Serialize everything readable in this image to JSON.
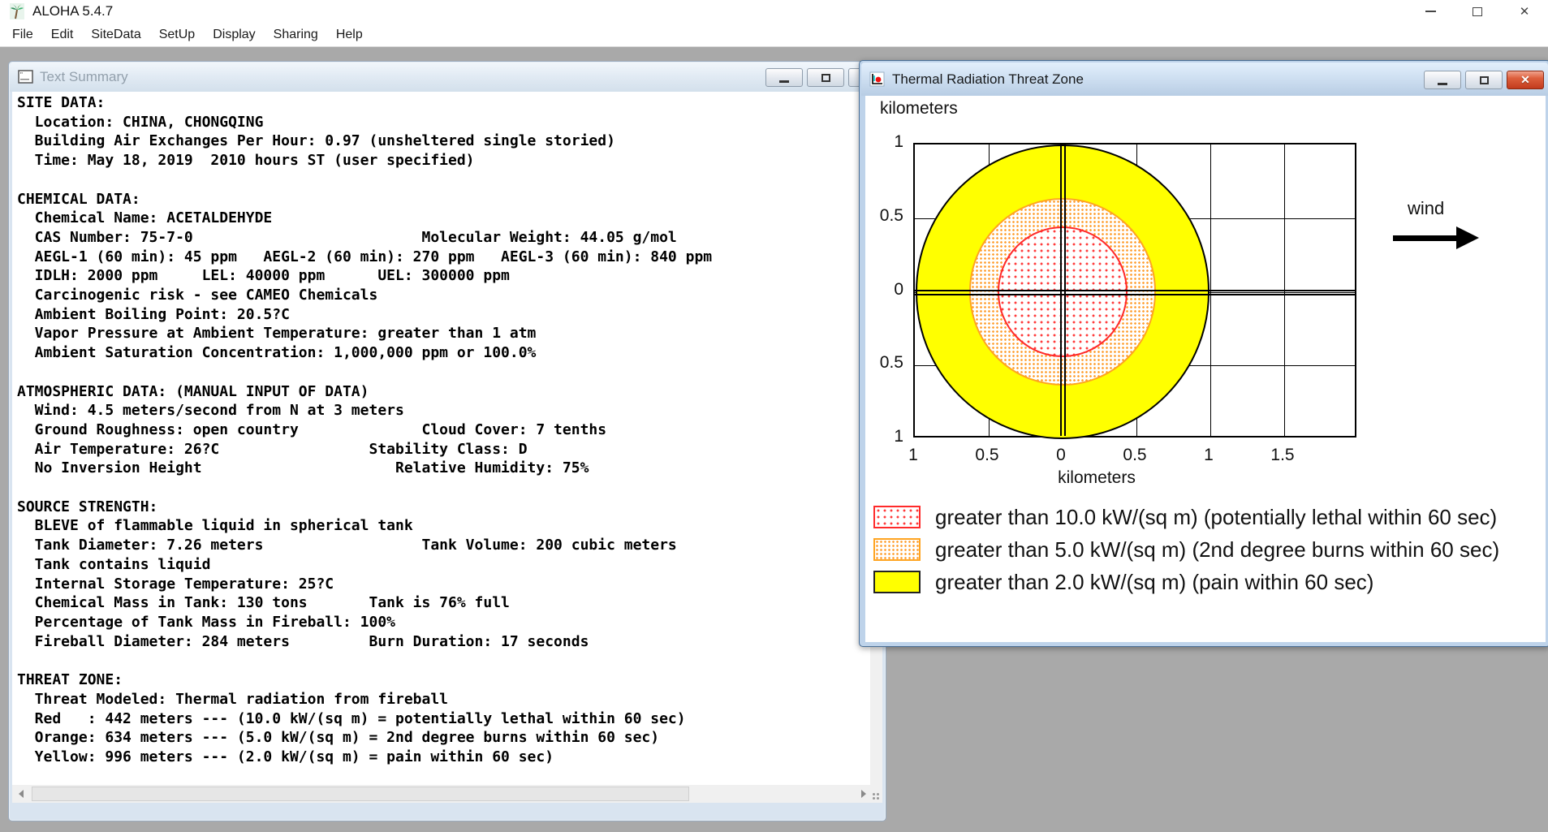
{
  "app": {
    "title": "ALOHA 5.4.7",
    "menu": [
      "File",
      "Edit",
      "SiteData",
      "SetUp",
      "Display",
      "Sharing",
      "Help"
    ]
  },
  "text_summary": {
    "title": "Text Summary",
    "lines": [
      "SITE DATA:",
      "  Location: CHINA, CHONGQING",
      "  Building Air Exchanges Per Hour: 0.97 (unsheltered single storied)",
      "  Time: May 18, 2019  2010 hours ST (user specified)",
      "",
      "CHEMICAL DATA:",
      "  Chemical Name: ACETALDEHYDE",
      "  CAS Number: 75-7-0                          Molecular Weight: 44.05 g/mol",
      "  AEGL-1 (60 min): 45 ppm   AEGL-2 (60 min): 270 ppm   AEGL-3 (60 min): 840 ppm",
      "  IDLH: 2000 ppm     LEL: 40000 ppm      UEL: 300000 ppm",
      "  Carcinogenic risk - see CAMEO Chemicals",
      "  Ambient Boiling Point: 20.5?C",
      "  Vapor Pressure at Ambient Temperature: greater than 1 atm",
      "  Ambient Saturation Concentration: 1,000,000 ppm or 100.0%",
      "",
      "ATMOSPHERIC DATA: (MANUAL INPUT OF DATA)",
      "  Wind: 4.5 meters/second from N at 3 meters",
      "  Ground Roughness: open country              Cloud Cover: 7 tenths",
      "  Air Temperature: 26?C                 Stability Class: D",
      "  No Inversion Height                      Relative Humidity: 75%",
      "",
      "SOURCE STRENGTH:",
      "  BLEVE of flammable liquid in spherical tank",
      "  Tank Diameter: 7.26 meters                  Tank Volume: 200 cubic meters",
      "  Tank contains liquid",
      "  Internal Storage Temperature: 25?C",
      "  Chemical Mass in Tank: 130 tons       Tank is 76% full",
      "  Percentage of Tank Mass in Fireball: 100%",
      "  Fireball Diameter: 284 meters         Burn Duration: 17 seconds",
      "",
      "THREAT ZONE:",
      "  Threat Modeled: Thermal radiation from fireball",
      "  Red   : 442 meters --- (10.0 kW/(sq m) = potentially lethal within 60 sec)",
      "  Orange: 634 meters --- (5.0 kW/(sq m) = 2nd degree burns within 60 sec)",
      "  Yellow: 996 meters --- (2.0 kW/(sq m) = pain within 60 sec)"
    ]
  },
  "threat_window": {
    "title": "Thermal Radiation Threat Zone"
  },
  "chart_data": {
    "type": "area",
    "title": "Thermal Radiation Threat Zone",
    "xlabel": "kilometers",
    "ylabel": "kilometers",
    "xlim": [
      -1,
      2
    ],
    "ylim": [
      -1,
      1
    ],
    "grid": true,
    "grid_step_km": 0.5,
    "x_tick_values": [
      -1,
      -0.5,
      0,
      0.5,
      1,
      1.5
    ],
    "x_tick_labels": [
      "1",
      "0.5",
      "0",
      "0.5",
      "1",
      "1.5"
    ],
    "y_tick_values": [
      1,
      0.5,
      0,
      -0.5,
      -1
    ],
    "y_tick_labels": [
      "1",
      "0.5",
      "0",
      "0.5",
      "1"
    ],
    "center_km": [
      0,
      0
    ],
    "wind_label": "wind",
    "wind_direction": "toward +x (east), from N source data",
    "zones": [
      {
        "name": "yellow",
        "radius_km": 0.996,
        "threshold": "2.0 kW/(sq m)",
        "effect": "pain within 60 sec",
        "fill": "#ffff00",
        "pattern": "solid"
      },
      {
        "name": "orange",
        "radius_km": 0.634,
        "threshold": "5.0 kW/(sq m)",
        "effect": "2nd degree burns within 60 sec",
        "fill": "#ff9d2e",
        "pattern": "dots"
      },
      {
        "name": "red",
        "radius_km": 0.442,
        "threshold": "10.0 kW/(sq m)",
        "effect": "potentially lethal within 60 sec",
        "fill": "#ff3b3b",
        "pattern": "dots"
      }
    ],
    "legend_position": "bottom"
  },
  "legend": [
    {
      "label": "greater than 10.0 kW/(sq m) (potentially lethal within 60 sec)",
      "swatch": "red-dots"
    },
    {
      "label": "greater than 5.0 kW/(sq m) (2nd degree burns within 60 sec)",
      "swatch": "orange-dots"
    },
    {
      "label": "greater than 2.0 kW/(sq m) (pain within 60 sec)",
      "swatch": "yellow-solid"
    }
  ],
  "colors": {
    "zone_yellow": "#ffff00",
    "zone_orange": "#ffa420",
    "zone_red": "#ff2a2a",
    "mdi_background": "#a9a9a9",
    "active_border": "#4a6f96",
    "close_button": "#c23b1e"
  }
}
